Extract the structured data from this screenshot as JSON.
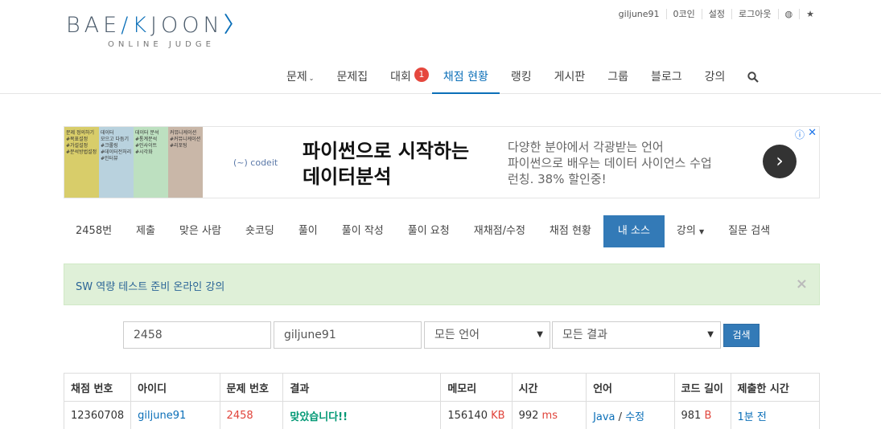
{
  "logo": {
    "main_left": "BAE",
    "main_k": "K",
    "main_right": "JOON",
    "sub": "ONLINE JUDGE"
  },
  "topbar": [
    "giljune91",
    "0코인",
    "설정",
    "로그아웃",
    "◍",
    "★"
  ],
  "mainnav": [
    {
      "label": "문제",
      "caret": "⌄"
    },
    {
      "label": "문제집"
    },
    {
      "label": "대회",
      "badge": "1"
    },
    {
      "label": "채점 현황"
    },
    {
      "label": "랭킹"
    },
    {
      "label": "게시판"
    },
    {
      "label": "그룹"
    },
    {
      "label": "블로그"
    },
    {
      "label": "강의"
    }
  ],
  "ad": {
    "thumbs": [
      "문제 정의하기\n#목표설정\n#가설설정\n#분석방법설정",
      "데이터\n모으고 다듬기\n#크롤링\n#데이터전처리\n#인터뷰",
      "데이터 분석\n#통계분석\n#인사이트\n#시각화",
      "커뮤니케이션\n#커뮤니케이션\n#리포팅"
    ],
    "brand": "(~) codeit",
    "title_line1": "파이썬으로 시작하는",
    "title_line2": "데이터분석",
    "desc_line1": "다양한 분야에서 각광받는 언어",
    "desc_line2": "파이썬으로 배우는 데이터 사이언스 수업",
    "desc_line3": "런칭. 38% 할인중!",
    "arrow": "›",
    "info": "ⓘ",
    "close": "✕"
  },
  "subnav": [
    "2458번",
    "제출",
    "맞은 사람",
    "숏코딩",
    "풀이",
    "풀이 작성",
    "풀이 요청",
    "재채점/수정",
    "채점 현황",
    "내 소스",
    "강의",
    "질문 검색"
  ],
  "subnav_active": "내 소스",
  "alert": {
    "text": "SW 역량 테스트 준비 온라인 강의",
    "close": "×"
  },
  "filter": {
    "problem_id": "2458",
    "user_id": "giljune91",
    "language": "모든 언어",
    "result": "모든 결과",
    "search_label": "검색"
  },
  "table": {
    "headers": [
      "채점 번호",
      "아이디",
      "문제 번호",
      "결과",
      "메모리",
      "시간",
      "언어",
      "코드 길이",
      "제출한 시간"
    ],
    "rows": [
      {
        "submission_id": "12360708",
        "user": "giljune91",
        "problem": "2458",
        "result": "맞았습니다!!",
        "memory": "156140",
        "memory_unit": "KB",
        "time": "992",
        "time_unit": "ms",
        "language": "Java",
        "lang_sep": "/",
        "edit": "수정",
        "code_length": "981",
        "code_unit": "B",
        "submitted": "1분 전"
      }
    ]
  },
  "colors": {
    "accent": "#0b6fb8",
    "active_tab": "#337ab7",
    "accepted": "#009874",
    "alert_bg": "#dff0d8"
  }
}
